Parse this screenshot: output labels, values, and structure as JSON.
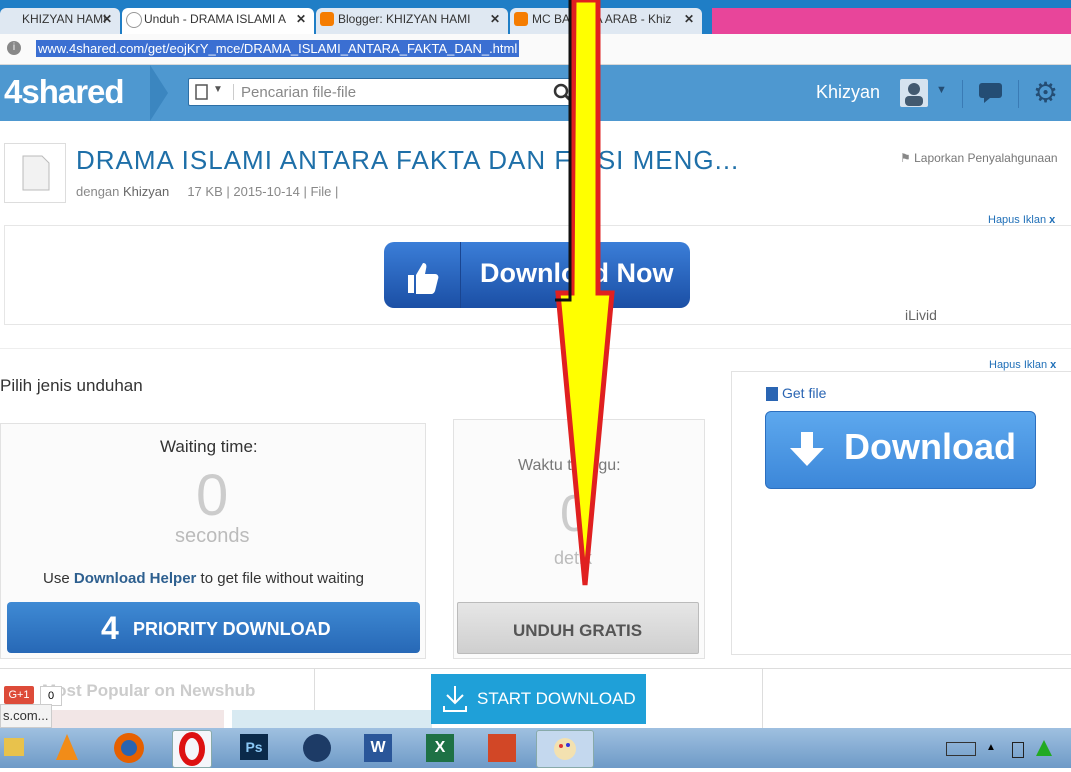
{
  "browser": {
    "tabs": [
      {
        "label": "KHIZYAN HAMI"
      },
      {
        "label": "Unduh - DRAMA ISLAMI A"
      },
      {
        "label": "Blogger: KHIZYAN HAMI"
      },
      {
        "label": "MC BAHASA ARAB - Khiz"
      }
    ],
    "url": "www.4shared.com/get/eojKrY_mce/DRAMA_ISLAMI_ANTARA_FAKTA_DAN_.html"
  },
  "header": {
    "logo": "4shared",
    "search_placeholder": "Pencarian file-file",
    "username": "Khizyan"
  },
  "file": {
    "title": "DRAMA ISLAMI ANTARA FAKTA DAN FIKSI MENG...",
    "by_label": "dengan",
    "author": "Khizyan",
    "size": "17 KB",
    "date": "2015-10-14",
    "type": "File",
    "report": "Laporkan Penyalahgunaan"
  },
  "ads": {
    "hide_label": "Hapus Iklan",
    "hide_x": "x",
    "download_now": "Download Now",
    "sponsor": "iLivid",
    "get_file": "Get file",
    "download": "Download"
  },
  "download": {
    "section_title": "Pilih jenis unduhan",
    "waiting_label": "Waiting time:",
    "waiting_value": "0",
    "seconds_label": "seconds",
    "helper_prefix": "Use",
    "helper_link": "Download Helper",
    "helper_suffix": "to get file without waiting",
    "priority_label": "PRIORITY DOWNLOAD",
    "priority_num": "4",
    "wait2_label": "Waktu tunggu:",
    "wait2_value": "0",
    "wait2_unit": "detik",
    "free_label": "UNDUH GRATIS",
    "start_label": "START DOWNLOAD"
  },
  "footer": {
    "newshub": "Most Popular on Newshub",
    "gplus": "G+1",
    "gplus_count": "0",
    "status_url": "s.com..."
  },
  "colors": {
    "header": "#4e98d0",
    "accent": "#2767bd",
    "arrow_fill": "#ffff00",
    "arrow_outline": "#e02020"
  }
}
